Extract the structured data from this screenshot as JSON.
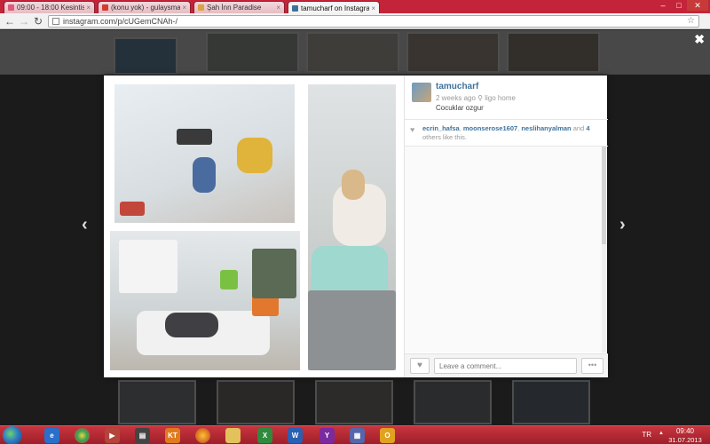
{
  "browser": {
    "tabs": [
      {
        "title": "09:00 - 18:00 Kesintisiz Mü",
        "color": "#e05a7a",
        "active": false
      },
      {
        "title": "(konu yok) - gulaysmail0",
        "color": "#d23a32",
        "active": false
      },
      {
        "title": "Şah İnn Paradise",
        "color": "#d9a441",
        "active": false
      },
      {
        "title": "tamucharf on Instagram",
        "color": "#3f729b",
        "active": true
      }
    ],
    "tab_close_glyph": "×",
    "url": "instagram.com/p/cUGemCNAh-/",
    "controls": {
      "minimize": "–",
      "maximize": "□",
      "close": "✕",
      "back": "←",
      "forward": "→",
      "reload": "↻",
      "star": "☆"
    }
  },
  "viewer": {
    "close_glyph": "✖",
    "prev_glyph": "‹",
    "next_glyph": "›"
  },
  "post": {
    "username": "tamucharf",
    "time_ago": "2 weeks ago",
    "location_glyph": "⚲",
    "location": "ligo home",
    "caption": "Cocuklar ozgur",
    "likers": [
      "ecrin_hafsa",
      "moonserose1607",
      "neslihanyalman"
    ],
    "likes_suffix_and": "and",
    "likes_others_count": "4",
    "likes_others_text": "others like this.",
    "comment_placeholder": "Leave a comment...",
    "like_glyph": "♥",
    "more_glyph": "•••"
  },
  "taskbar": {
    "apps": [
      {
        "name": "internet-explorer-icon",
        "label": "e",
        "color": "#2a6fc9"
      },
      {
        "name": "chrome-icon",
        "label": "",
        "color": "#3aa655"
      },
      {
        "name": "media-player-icon",
        "label": "▶",
        "color": "#b3453a"
      },
      {
        "name": "window-app-icon",
        "label": "▤",
        "color": "#444444"
      },
      {
        "name": "kt-app-icon",
        "label": "KT",
        "color": "#e07a1f"
      },
      {
        "name": "firefox-icon",
        "label": "",
        "color": "#e0711f"
      },
      {
        "name": "folder-icon",
        "label": "",
        "color": "#e3c15b"
      },
      {
        "name": "excel-icon",
        "label": "X",
        "color": "#2f8a3e"
      },
      {
        "name": "word-icon",
        "label": "W",
        "color": "#2b5fb3"
      },
      {
        "name": "yahoo-icon",
        "label": "Y",
        "color": "#7b2aa0"
      },
      {
        "name": "calendar-app-icon",
        "label": "▦",
        "color": "#5566aa"
      },
      {
        "name": "outlook-icon",
        "label": "O",
        "color": "#e0a220"
      }
    ],
    "language": "TR",
    "tray_arrow": "▲",
    "time": "09:40",
    "date": "31.07.2013"
  }
}
